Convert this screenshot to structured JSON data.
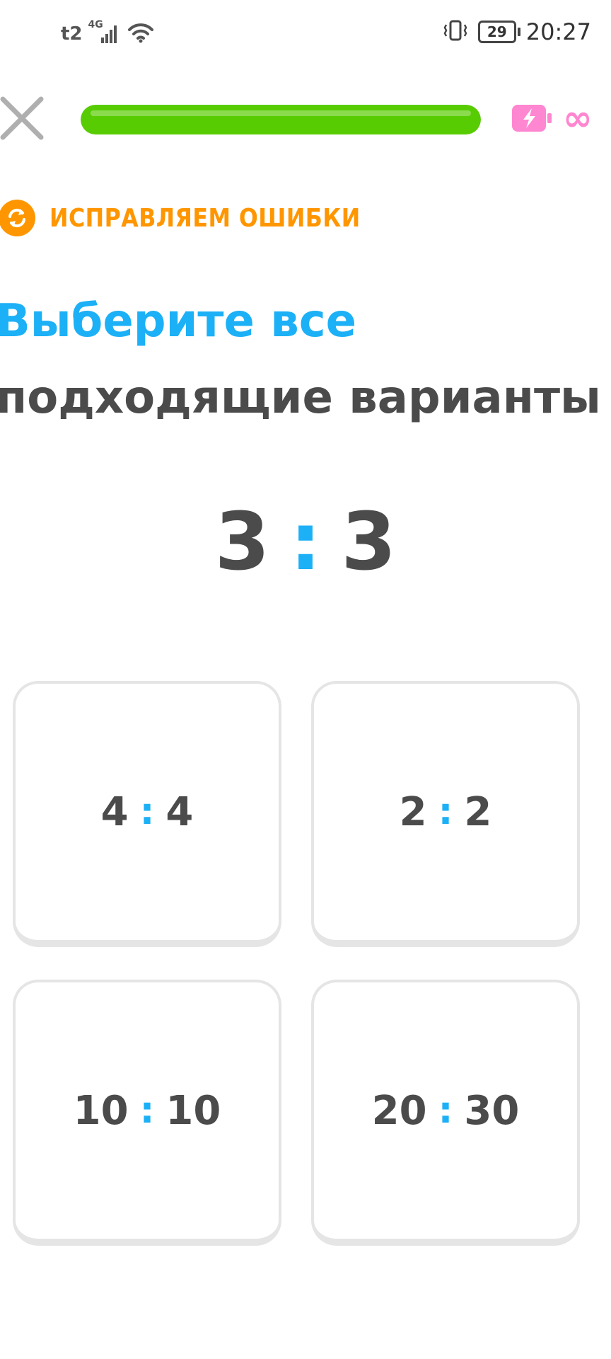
{
  "status_bar": {
    "carrier": "t2",
    "network": "4G",
    "battery_level": "29",
    "time": "20:27"
  },
  "lesson": {
    "progress_percent": 100,
    "progress_color": "#58cc02",
    "energy_value": "∞",
    "energy_color": "#ff86d0"
  },
  "review_label": "ИСПРАВЛЯЕМ ОШИБКИ",
  "title": {
    "highlight": "Выберите все",
    "rest": "подходящие варианты"
  },
  "prompt": {
    "left": "3",
    "separator": ":",
    "right": "3"
  },
  "options": [
    {
      "left": "4",
      "separator": ":",
      "right": "4"
    },
    {
      "left": "2",
      "separator": ":",
      "right": "2"
    },
    {
      "left": "10",
      "separator": ":",
      "right": "10"
    },
    {
      "left": "20",
      "separator": ":",
      "right": "30"
    }
  ],
  "colors": {
    "accent_blue": "#1cb0f6",
    "review_orange": "#ff9600",
    "text_dark": "#4b4b4b"
  }
}
